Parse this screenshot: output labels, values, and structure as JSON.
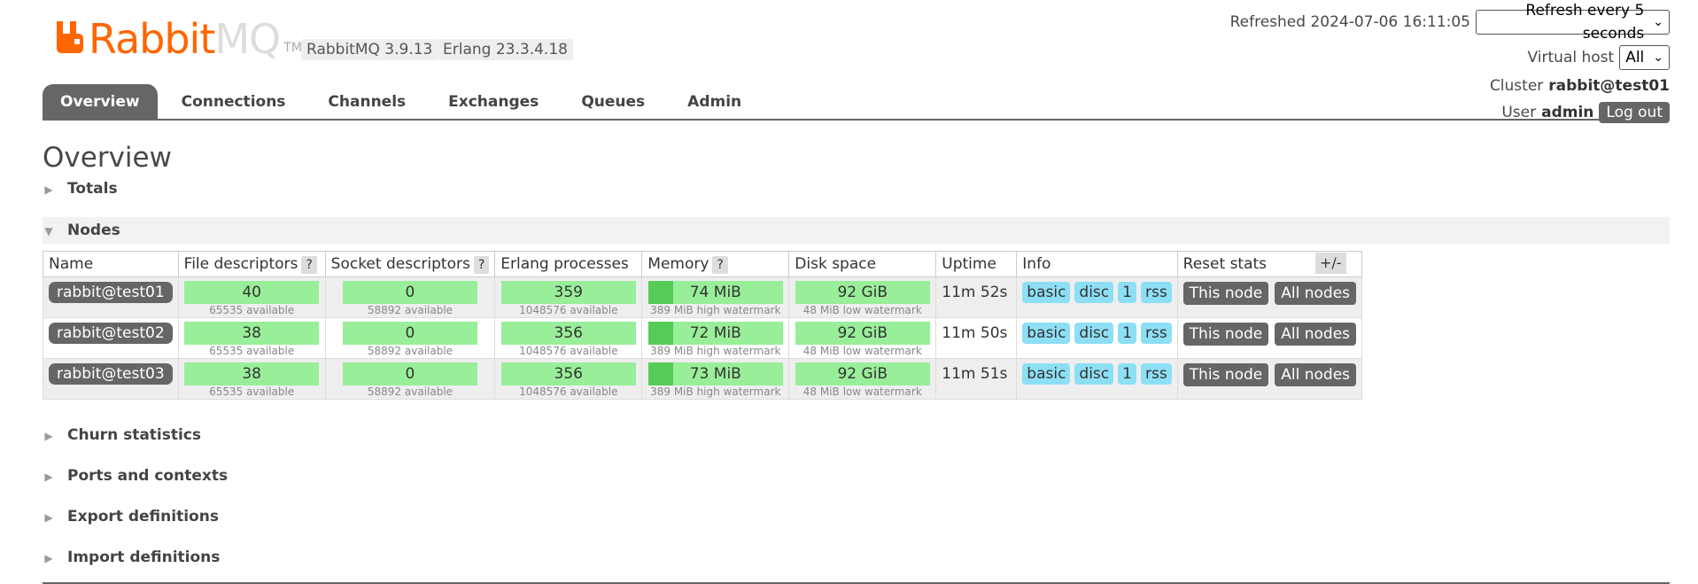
{
  "header": {
    "logo_rabbit": "Rabbit",
    "logo_mq": "MQ",
    "logo_tm": "TM",
    "version": "RabbitMQ 3.9.13",
    "erlang": "Erlang 23.3.4.18"
  },
  "tabs": [
    {
      "label": "Overview"
    },
    {
      "label": "Connections"
    },
    {
      "label": "Channels"
    },
    {
      "label": "Exchanges"
    },
    {
      "label": "Queues"
    },
    {
      "label": "Admin"
    }
  ],
  "topright": {
    "refreshed_label": "Refreshed 2024-07-06 16:11:05",
    "refresh_select": "Refresh every 5 seconds",
    "vhost_label": "Virtual host",
    "vhost_select": "All",
    "cluster_label": "Cluster",
    "cluster_name": "rabbit@test01",
    "user_label": "User",
    "user_name": "admin",
    "logout": "Log out"
  },
  "page_title": "Overview",
  "sections": {
    "totals": "Totals",
    "nodes": "Nodes",
    "churn": "Churn statistics",
    "ports": "Ports and contexts",
    "export": "Export definitions",
    "import": "Import definitions"
  },
  "table": {
    "headers": {
      "name": "Name",
      "fd": "File descriptors",
      "sd": "Socket descriptors",
      "ep": "Erlang processes",
      "mem": "Memory",
      "disk": "Disk space",
      "uptime": "Uptime",
      "info": "Info",
      "reset": "Reset stats",
      "help": "?"
    },
    "plusminus": "+/-",
    "rows": [
      {
        "name": "rabbit@test01",
        "fd": "40",
        "fd_sub": "65535 available",
        "sd": "0",
        "sd_sub": "58892 available",
        "ep": "359",
        "ep_sub": "1048576 available",
        "mem": "74 MiB",
        "mem_sub": "389 MiB high watermark",
        "disk": "92 GiB",
        "disk_sub": "48 MiB low watermark",
        "uptime": "11m 52s",
        "info": [
          "basic",
          "disc",
          "1",
          "rss"
        ],
        "this_node": "This node",
        "all_nodes": "All nodes"
      },
      {
        "name": "rabbit@test02",
        "fd": "38",
        "fd_sub": "65535 available",
        "sd": "0",
        "sd_sub": "58892 available",
        "ep": "356",
        "ep_sub": "1048576 available",
        "mem": "72 MiB",
        "mem_sub": "389 MiB high watermark",
        "disk": "92 GiB",
        "disk_sub": "48 MiB low watermark",
        "uptime": "11m 50s",
        "info": [
          "basic",
          "disc",
          "1",
          "rss"
        ],
        "this_node": "This node",
        "all_nodes": "All nodes"
      },
      {
        "name": "rabbit@test03",
        "fd": "38",
        "fd_sub": "65535 available",
        "sd": "0",
        "sd_sub": "58892 available",
        "ep": "356",
        "ep_sub": "1048576 available",
        "mem": "73 MiB",
        "mem_sub": "389 MiB high watermark",
        "disk": "92 GiB",
        "disk_sub": "48 MiB low watermark",
        "uptime": "11m 51s",
        "info": [
          "basic",
          "disc",
          "1",
          "rss"
        ],
        "this_node": "This node",
        "all_nodes": "All nodes"
      }
    ]
  },
  "colors": {
    "brand": "#ff6600",
    "bar_ok": "#99ee99",
    "bar_fill": "#55cc55",
    "info_badge": "#8ddff5",
    "dark_button": "#666666"
  }
}
